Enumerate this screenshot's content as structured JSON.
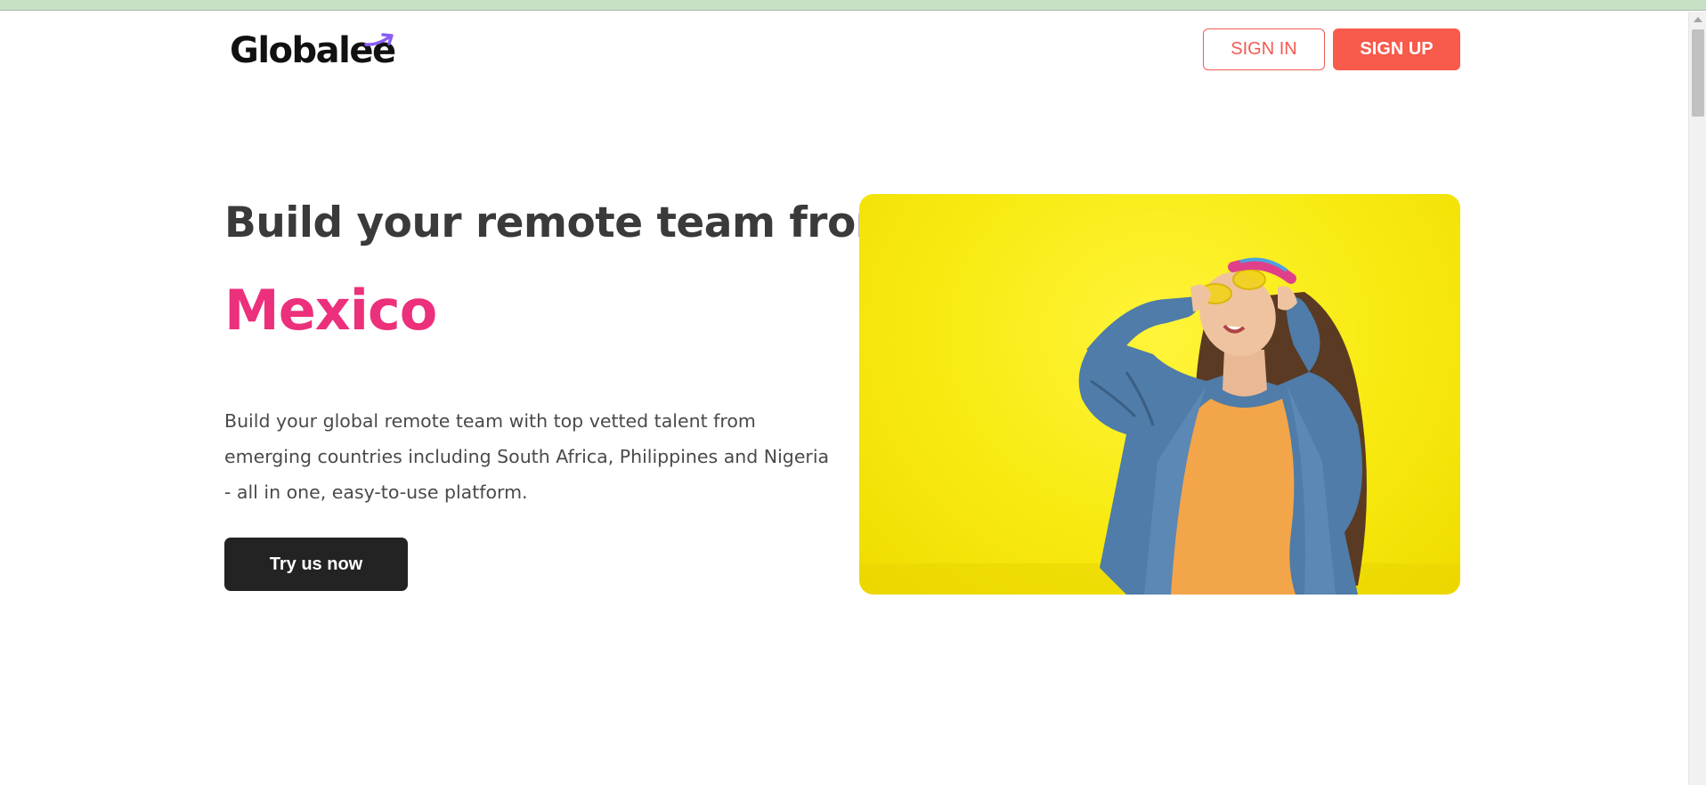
{
  "header": {
    "logo_text": "Globalee",
    "signin_label": "SIGN IN",
    "signup_label": "SIGN UP"
  },
  "hero": {
    "title": "Build your remote team from",
    "country": "Mexico",
    "description": "Build your global remote team with top vetted talent from emerging countries including South Africa, Philippines and Nigeria - all in one, easy-to-use platform.",
    "cta_label": "Try us now"
  },
  "colors": {
    "accent_red": "#f85a4c",
    "accent_pink": "#ec307b",
    "logo_purple": "#8b5cf6",
    "image_yellow": "#f8ea10",
    "cta_dark": "#232323"
  },
  "icons": {
    "logo_mark": "swoosh-arrow-icon",
    "scroll_up": "triangle-up-icon"
  }
}
